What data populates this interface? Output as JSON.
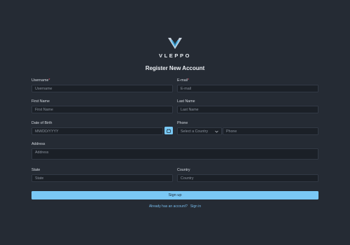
{
  "brand": {
    "name": "VLEPPO",
    "colors": {
      "primary": "#78c8f4",
      "background": "#252b34"
    }
  },
  "form": {
    "title": "Register New Account",
    "username": {
      "label": "Username",
      "required": "*",
      "placeholder": "Username"
    },
    "email": {
      "label": "E-mail",
      "required": "*",
      "placeholder": "E-mail"
    },
    "first_name": {
      "label": "First Name",
      "placeholder": "First Name"
    },
    "last_name": {
      "label": "Last Name",
      "placeholder": "Last Name"
    },
    "dob": {
      "label": "Date of Birth",
      "placeholder": "MM/DD/YYYY",
      "icon": "calendar-icon"
    },
    "phone": {
      "label": "Phone",
      "country_select": "Select a Country",
      "placeholder": "Phone"
    },
    "address": {
      "label": "Address",
      "placeholder": "Address"
    },
    "state": {
      "label": "State",
      "placeholder": "State"
    },
    "country": {
      "label": "Country",
      "placeholder": "Country"
    },
    "submit_label": "Sign up",
    "already_text": "Already has an account?",
    "signin_link": "Sign in"
  }
}
